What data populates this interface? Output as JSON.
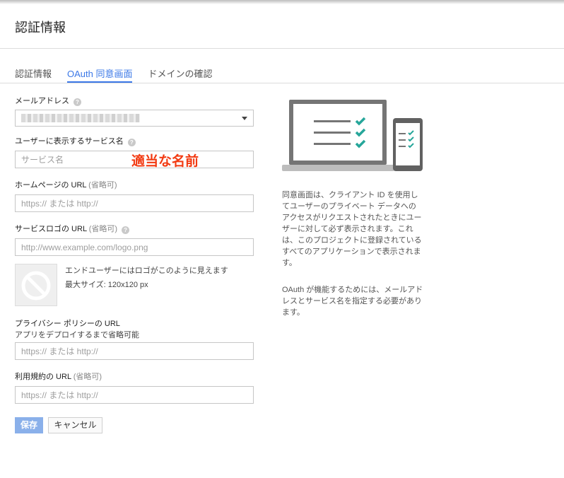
{
  "header": {
    "title": "認証情報"
  },
  "tabs": [
    {
      "label": "認証情報",
      "active": false
    },
    {
      "label": "OAuth 同意画面",
      "active": true
    },
    {
      "label": "ドメインの確認",
      "active": false
    }
  ],
  "form": {
    "email": {
      "label": "メールアドレス",
      "icon": "help-icon"
    },
    "product_name": {
      "label": "ユーザーに表示するサービス名",
      "icon": "help-icon",
      "placeholder": "サービス名"
    },
    "annotation": "適当な名前",
    "homepage": {
      "label": "ホームページの URL",
      "optional": "(省略可)",
      "placeholder": "https:// または http://"
    },
    "logo_url": {
      "label": "サービスロゴの URL",
      "optional": "(省略可)",
      "icon": "help-icon",
      "placeholder": "http://www.example.com/logo.png"
    },
    "logo_preview": {
      "line1": "エンドユーザーにはロゴがこのように見えます",
      "line2": "最大サイズ: 120x120 px",
      "icon": "no-image-icon"
    },
    "privacy": {
      "label": "プライバシー ポリシーの URL",
      "sublabel": "アプリをデプロイするまで省略可能",
      "placeholder": "https:// または http://"
    },
    "tos": {
      "label": "利用規約の URL",
      "optional": "(省略可)",
      "placeholder": "https:// または http://"
    },
    "save_label": "保存",
    "cancel_label": "キャンセル"
  },
  "sidebar": {
    "illustration": "laptop-phone-checklist-illustration",
    "paragraph1": "同意画面は、クライアント ID を使用してユーザーのプライベート データへのアクセスがリクエストされたときにユーザーに対して必ず表示されます。これは、このプロジェクトに登録されているすべてのアプリケーションで表示されます。",
    "paragraph2": "OAuth が機能するためには、メールアドレスとサービス名を指定する必要があります。"
  },
  "colors": {
    "accent": "#3b78e7",
    "check": "#26a69a",
    "annotation": "#f23a12",
    "save_button": "#8ab0ea"
  }
}
